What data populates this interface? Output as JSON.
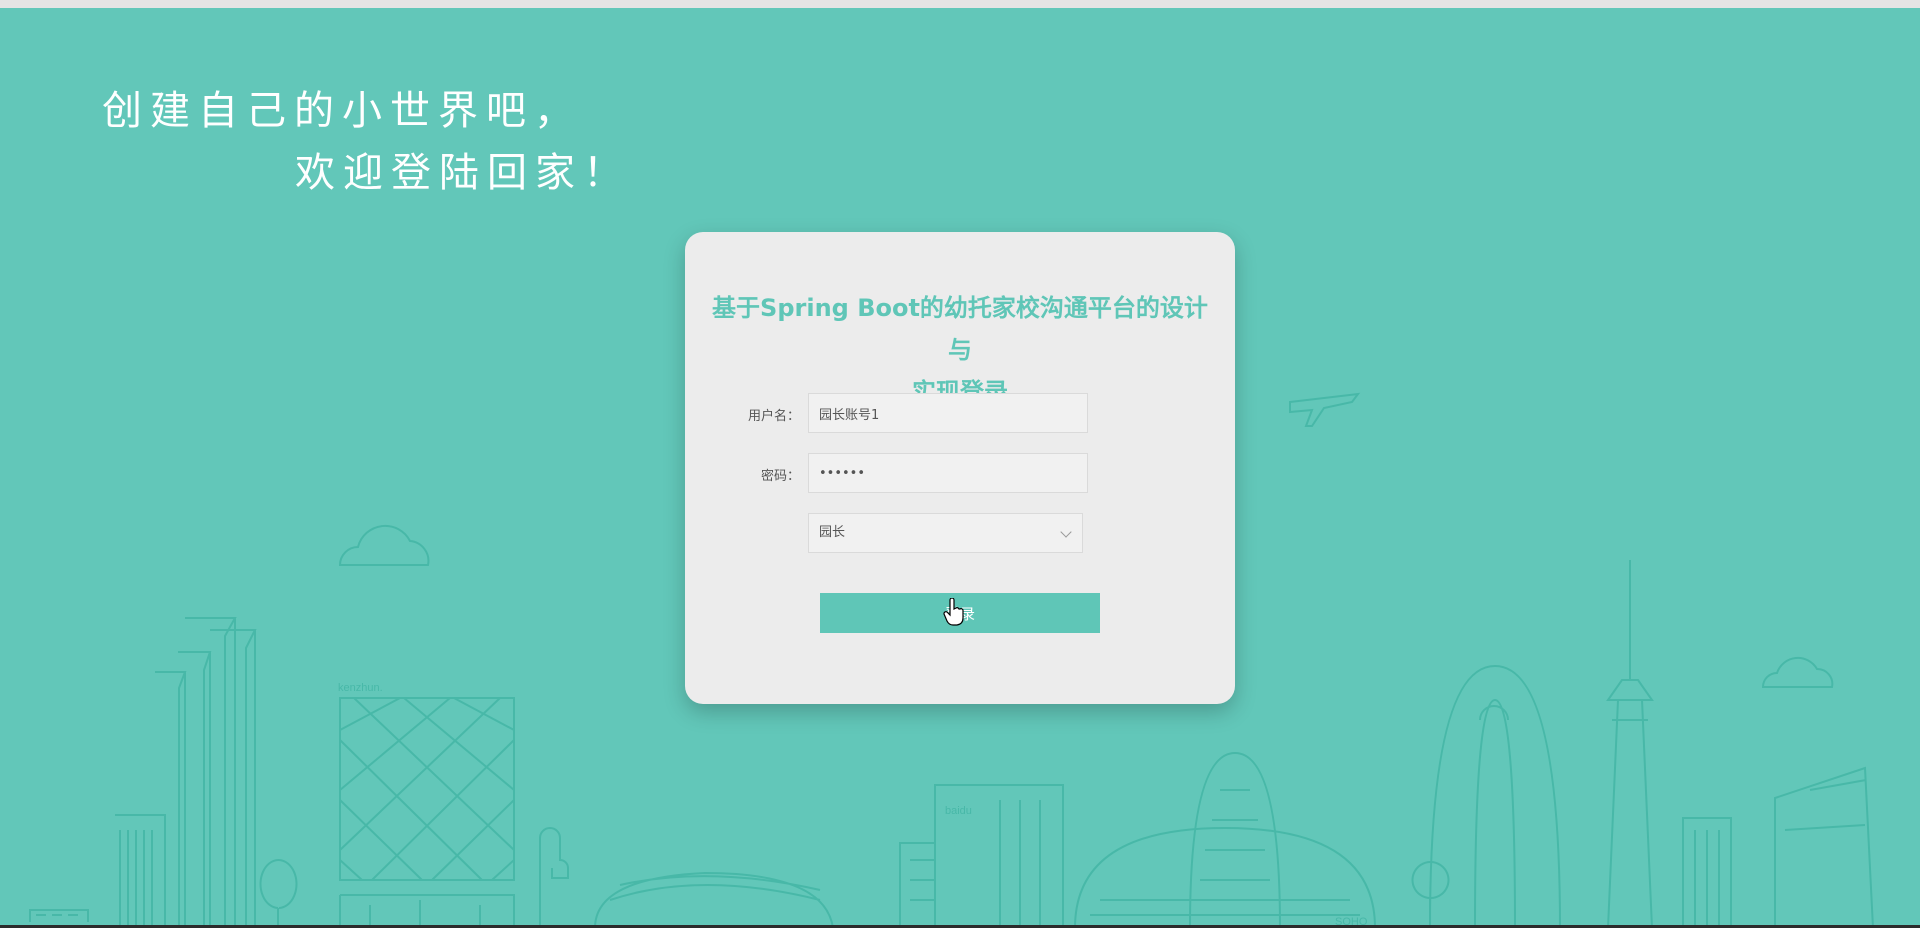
{
  "slogan": {
    "line1": "创建自己的小世界吧，",
    "line2": "欢迎登陆回家！"
  },
  "login": {
    "title_line1": "基于Spring Boot的幼托家校沟通平台的设计与",
    "title_line2": "实现登录",
    "username_label": "用户名：",
    "username_value": "园长账号1",
    "password_label": "密码：",
    "password_value": "123456",
    "role_selected": "园长",
    "submit_label": "登录"
  },
  "skyline_labels": {
    "kenzhun": "kenzhun.",
    "baidu": "baidu",
    "soho": "SOHO"
  },
  "colors": {
    "background": "#62c7b9",
    "accent": "#5fc6b7",
    "line": "#48b8a8"
  }
}
